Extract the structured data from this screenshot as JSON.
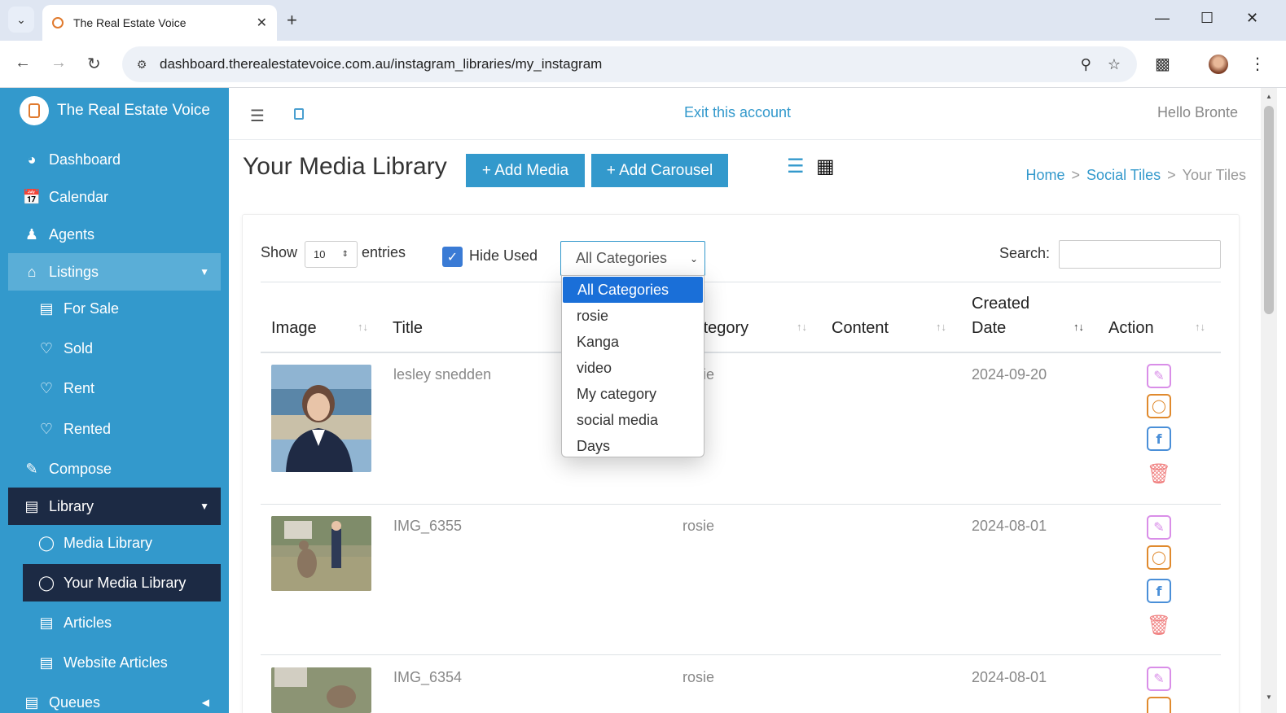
{
  "browser": {
    "tab_title": "The Real Estate Voice",
    "url_host": "dashboard.therealestatevoice.com.au",
    "url_path": "/instagram_libraries/my_instagram"
  },
  "sidebar": {
    "brand": "The Real Estate Voice",
    "items": [
      {
        "label": "Dashboard",
        "icon": "dashboard-icon"
      },
      {
        "label": "Calendar",
        "icon": "calendar-icon"
      },
      {
        "label": "Agents",
        "icon": "agent-icon"
      },
      {
        "label": "Listings",
        "icon": "house-icon"
      },
      {
        "label": "For Sale",
        "icon": "for-sale-icon"
      },
      {
        "label": "Sold",
        "icon": "sold-icon"
      },
      {
        "label": "Rent",
        "icon": "rent-icon"
      },
      {
        "label": "Rented",
        "icon": "rented-icon"
      },
      {
        "label": "Compose",
        "icon": "compose-icon"
      },
      {
        "label": "Library",
        "icon": "library-icon"
      },
      {
        "label": "Media Library",
        "icon": "instagram-icon"
      },
      {
        "label": "Your Media Library",
        "icon": "user-media-icon"
      },
      {
        "label": "Articles",
        "icon": "article-icon"
      },
      {
        "label": "Website Articles",
        "icon": "website-article-icon"
      },
      {
        "label": "Queues",
        "icon": "queue-icon"
      }
    ]
  },
  "topbar": {
    "exit_link": "Exit this account",
    "greeting": "Hello Bronte"
  },
  "page": {
    "title": "Your Media Library",
    "add_media": "+ Add Media",
    "add_carousel": "+ Add Carousel",
    "breadcrumb": [
      "Home",
      "Social Tiles",
      "Your Tiles"
    ],
    "breadcrumb_sep": ">"
  },
  "table_controls": {
    "show_label": "Show",
    "entries_value": "10",
    "entries_label": "entries",
    "hide_used_label": "Hide Used",
    "hide_used_checked": true,
    "category_selected": "All Categories",
    "category_options": [
      "All Categories",
      "rosie",
      "Kanga",
      "video",
      "My category",
      "social media",
      "Days"
    ],
    "search_label": "Search:"
  },
  "table": {
    "headers": [
      "Image",
      "Title",
      "Category",
      "Content",
      "Created",
      "Date",
      "Action"
    ],
    "rows": [
      {
        "title": "lesley snedden",
        "category": "rosie",
        "content": "",
        "date": "2024-09-20"
      },
      {
        "title": "IMG_6355",
        "category": "rosie",
        "content": "",
        "date": "2024-08-01"
      },
      {
        "title": "IMG_6354",
        "category": "rosie",
        "content": "",
        "date": "2024-08-01"
      }
    ]
  },
  "colors": {
    "sidebar": "#3399cc",
    "sidebar_active": "#1c2a44",
    "primary": "#3399cc",
    "dropdown_highlight": "#1a6fd8"
  }
}
